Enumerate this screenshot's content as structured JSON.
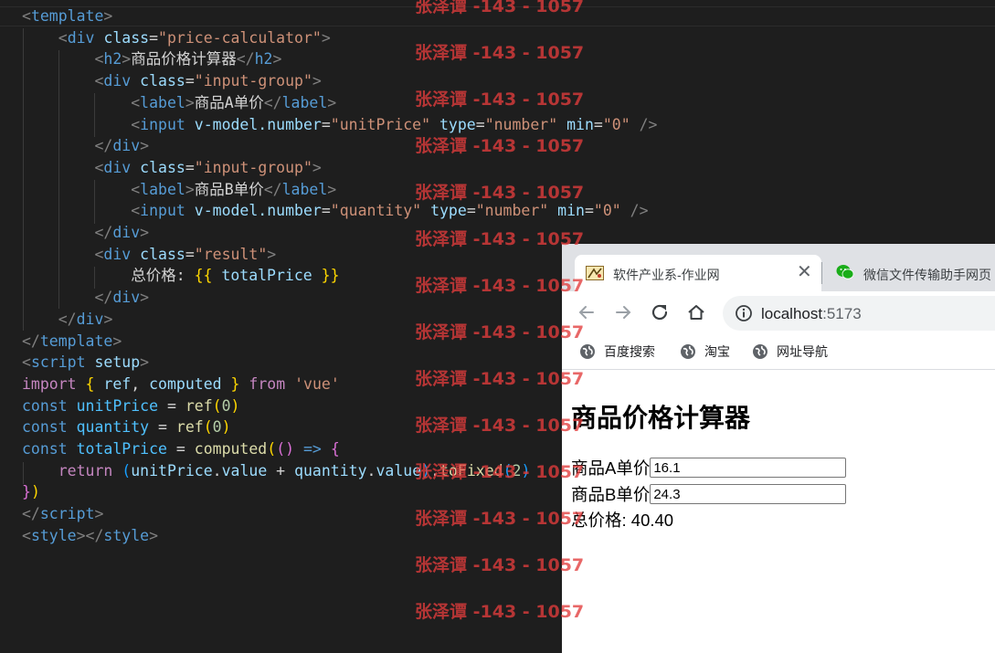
{
  "editor": {
    "lines": [
      [
        [
          "t-brk",
          "<"
        ],
        [
          "t-tag",
          "template"
        ],
        [
          "t-brk",
          ">"
        ]
      ],
      [
        [
          "t-txt",
          "    "
        ],
        [
          "t-brk",
          "<"
        ],
        [
          "t-tag",
          "div"
        ],
        [
          "t-txt",
          " "
        ],
        [
          "t-attr",
          "class"
        ],
        [
          "t-txt",
          "="
        ],
        [
          "t-str",
          "\"price-calculator\""
        ],
        [
          "t-brk",
          ">"
        ]
      ],
      [
        [
          "t-txt",
          "        "
        ],
        [
          "t-brk",
          "<"
        ],
        [
          "t-tag",
          "h2"
        ],
        [
          "t-brk",
          ">"
        ],
        [
          "t-txt",
          "商品价格计算器"
        ],
        [
          "t-brk",
          "</"
        ],
        [
          "t-tag",
          "h2"
        ],
        [
          "t-brk",
          ">"
        ]
      ],
      [
        [
          "t-txt",
          "        "
        ],
        [
          "t-brk",
          "<"
        ],
        [
          "t-tag",
          "div"
        ],
        [
          "t-txt",
          " "
        ],
        [
          "t-attr",
          "class"
        ],
        [
          "t-txt",
          "="
        ],
        [
          "t-str",
          "\"input-group\""
        ],
        [
          "t-brk",
          ">"
        ]
      ],
      [
        [
          "t-txt",
          "            "
        ],
        [
          "t-brk",
          "<"
        ],
        [
          "t-tag",
          "label"
        ],
        [
          "t-brk",
          ">"
        ],
        [
          "t-txt",
          "商品A单价"
        ],
        [
          "t-brk",
          "</"
        ],
        [
          "t-tag",
          "label"
        ],
        [
          "t-brk",
          ">"
        ]
      ],
      [
        [
          "t-txt",
          "            "
        ],
        [
          "t-brk",
          "<"
        ],
        [
          "t-tag",
          "input"
        ],
        [
          "t-txt",
          " "
        ],
        [
          "t-attr",
          "v-model.number"
        ],
        [
          "t-txt",
          "="
        ],
        [
          "t-str",
          "\"unitPrice\""
        ],
        [
          "t-txt",
          " "
        ],
        [
          "t-attr",
          "type"
        ],
        [
          "t-txt",
          "="
        ],
        [
          "t-str",
          "\"number\""
        ],
        [
          "t-txt",
          " "
        ],
        [
          "t-attr",
          "min"
        ],
        [
          "t-txt",
          "="
        ],
        [
          "t-str",
          "\"0\""
        ],
        [
          "t-txt",
          " "
        ],
        [
          "t-brk",
          "/>"
        ]
      ],
      [
        [
          "t-txt",
          "        "
        ],
        [
          "t-brk",
          "</"
        ],
        [
          "t-tag",
          "div"
        ],
        [
          "t-brk",
          ">"
        ]
      ],
      [
        [
          "t-txt",
          "        "
        ],
        [
          "t-brk",
          "<"
        ],
        [
          "t-tag",
          "div"
        ],
        [
          "t-txt",
          " "
        ],
        [
          "t-attr",
          "class"
        ],
        [
          "t-txt",
          "="
        ],
        [
          "t-str",
          "\"input-group\""
        ],
        [
          "t-brk",
          ">"
        ]
      ],
      [
        [
          "t-txt",
          "            "
        ],
        [
          "t-brk",
          "<"
        ],
        [
          "t-tag",
          "label"
        ],
        [
          "t-brk",
          ">"
        ],
        [
          "t-txt",
          "商品B单价"
        ],
        [
          "t-brk",
          "</"
        ],
        [
          "t-tag",
          "label"
        ],
        [
          "t-brk",
          ">"
        ]
      ],
      [
        [
          "t-txt",
          "            "
        ],
        [
          "t-brk",
          "<"
        ],
        [
          "t-tag",
          "input"
        ],
        [
          "t-txt",
          " "
        ],
        [
          "t-attr",
          "v-model.number"
        ],
        [
          "t-txt",
          "="
        ],
        [
          "t-str",
          "\"quantity\""
        ],
        [
          "t-txt",
          " "
        ],
        [
          "t-attr",
          "type"
        ],
        [
          "t-txt",
          "="
        ],
        [
          "t-str",
          "\"number\""
        ],
        [
          "t-txt",
          " "
        ],
        [
          "t-attr",
          "min"
        ],
        [
          "t-txt",
          "="
        ],
        [
          "t-str",
          "\"0\""
        ],
        [
          "t-txt",
          " "
        ],
        [
          "t-brk",
          "/>"
        ]
      ],
      [
        [
          "t-txt",
          "        "
        ],
        [
          "t-brk",
          "</"
        ],
        [
          "t-tag",
          "div"
        ],
        [
          "t-brk",
          ">"
        ]
      ],
      [
        [
          "t-txt",
          "        "
        ],
        [
          "t-brk",
          "<"
        ],
        [
          "t-tag",
          "div"
        ],
        [
          "t-txt",
          " "
        ],
        [
          "t-attr",
          "class"
        ],
        [
          "t-txt",
          "="
        ],
        [
          "t-str",
          "\"result\""
        ],
        [
          "t-brk",
          ">"
        ]
      ],
      [
        [
          "t-txt",
          "            总价格: "
        ],
        [
          "t-br1",
          "{{"
        ],
        [
          "t-attr",
          " totalPrice "
        ],
        [
          "t-br1",
          "}}"
        ]
      ],
      [
        [
          "t-txt",
          "        "
        ],
        [
          "t-brk",
          "</"
        ],
        [
          "t-tag",
          "div"
        ],
        [
          "t-brk",
          ">"
        ]
      ],
      [
        [
          "t-txt",
          "    "
        ],
        [
          "t-brk",
          "</"
        ],
        [
          "t-tag",
          "div"
        ],
        [
          "t-brk",
          ">"
        ]
      ],
      [
        [
          "t-brk",
          "</"
        ],
        [
          "t-tag",
          "template"
        ],
        [
          "t-brk",
          ">"
        ]
      ],
      [
        [
          "t-brk",
          "<"
        ],
        [
          "t-tag",
          "script"
        ],
        [
          "t-txt",
          " "
        ],
        [
          "t-attr",
          "setup"
        ],
        [
          "t-brk",
          ">"
        ]
      ],
      [
        [
          "t-kw",
          "import"
        ],
        [
          "t-txt",
          " "
        ],
        [
          "t-br1",
          "{"
        ],
        [
          "t-attr",
          " ref"
        ],
        [
          "t-txt",
          ", "
        ],
        [
          "t-attr",
          "computed "
        ],
        [
          "t-br1",
          "}"
        ],
        [
          "t-txt",
          " "
        ],
        [
          "t-kw",
          "from"
        ],
        [
          "t-txt",
          " "
        ],
        [
          "t-str",
          "'vue'"
        ]
      ],
      [
        [
          "t-decl",
          "const"
        ],
        [
          "t-txt",
          " "
        ],
        [
          "t-var",
          "unitPrice"
        ],
        [
          "t-txt",
          " = "
        ],
        [
          "t-fn",
          "ref"
        ],
        [
          "t-br1",
          "("
        ],
        [
          "t-num",
          "0"
        ],
        [
          "t-br1",
          ")"
        ]
      ],
      [
        [
          "t-decl",
          "const"
        ],
        [
          "t-txt",
          " "
        ],
        [
          "t-var",
          "quantity"
        ],
        [
          "t-txt",
          " = "
        ],
        [
          "t-fn",
          "ref"
        ],
        [
          "t-br1",
          "("
        ],
        [
          "t-num",
          "0"
        ],
        [
          "t-br1",
          ")"
        ]
      ],
      [
        [
          "t-decl",
          "const"
        ],
        [
          "t-txt",
          " "
        ],
        [
          "t-var",
          "totalPrice"
        ],
        [
          "t-txt",
          " = "
        ],
        [
          "t-fn",
          "computed"
        ],
        [
          "t-br1",
          "("
        ],
        [
          "t-br2",
          "()"
        ],
        [
          "t-txt",
          " "
        ],
        [
          "t-decl",
          "=>"
        ],
        [
          "t-txt",
          " "
        ],
        [
          "t-br2",
          "{"
        ]
      ],
      [
        [
          "t-txt",
          "    "
        ],
        [
          "t-kw",
          "return"
        ],
        [
          "t-txt",
          " "
        ],
        [
          "t-br3",
          "("
        ],
        [
          "t-attr",
          "unitPrice"
        ],
        [
          "t-txt",
          "."
        ],
        [
          "t-attr",
          "value"
        ],
        [
          "t-txt",
          " + "
        ],
        [
          "t-attr",
          "quantity"
        ],
        [
          "t-txt",
          "."
        ],
        [
          "t-attr",
          "value"
        ],
        [
          "t-br3",
          ")"
        ],
        [
          "t-txt",
          "."
        ],
        [
          "t-fn",
          "toFixed"
        ],
        [
          "t-br3",
          "("
        ],
        [
          "t-num",
          "2"
        ],
        [
          "t-br3",
          ")"
        ]
      ],
      [
        [
          "t-br2",
          "}"
        ],
        [
          "t-br1",
          ")"
        ]
      ],
      [
        [
          "t-brk",
          "</"
        ],
        [
          "t-tag",
          "script"
        ],
        [
          "t-brk",
          ">"
        ]
      ],
      [
        [
          "t-brk",
          "<"
        ],
        [
          "t-tag",
          "style"
        ],
        [
          "t-brk",
          "></"
        ],
        [
          "t-tag",
          "style"
        ],
        [
          "t-brk",
          ">"
        ]
      ]
    ]
  },
  "watermark": {
    "text": "张泽谭 -143 - 1057"
  },
  "browser": {
    "tab_active_title": "软件产业系-作业网",
    "tab_close_glyph": "✕",
    "tab2_title": "微信文件传输助手网页",
    "url_host": "localhost",
    "url_port": ":5173",
    "bookmarks": [
      "百度搜索",
      "淘宝",
      "网址导航"
    ]
  },
  "page": {
    "title": "商品价格计算器",
    "label_a": "商品A单价",
    "value_a": "16.1",
    "label_b": "商品B单价",
    "value_b": "24.3",
    "result_label": "总价格:",
    "result_value": "40.40"
  },
  "colors": {
    "editor_bg": "#1e1e1e",
    "watermark": "#e23c3c",
    "tab_strip": "#dfe1e5",
    "wechat_green": "#1aad19"
  }
}
